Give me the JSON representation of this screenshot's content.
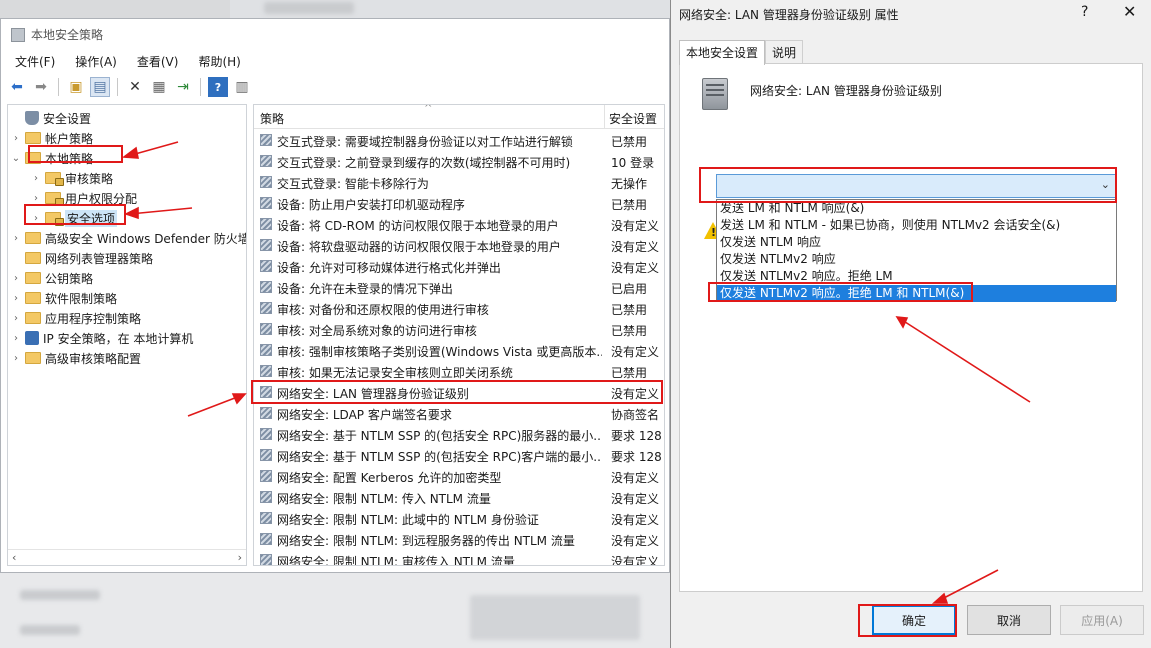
{
  "mmc": {
    "title": "本地安全策略",
    "menu": [
      "文件(F)",
      "操作(A)",
      "查看(V)",
      "帮助(H)"
    ],
    "tree": [
      {
        "label": "安全设置",
        "level": 0,
        "icon": "shield"
      },
      {
        "label": "帐户策略",
        "level": 1,
        "icon": "folder"
      },
      {
        "label": "本地策略",
        "level": 1,
        "icon": "folder",
        "expanded": true
      },
      {
        "label": "审核策略",
        "level": 2,
        "icon": "folder-lock"
      },
      {
        "label": "用户权限分配",
        "level": 2,
        "icon": "folder-lock"
      },
      {
        "label": "安全选项",
        "level": 2,
        "icon": "folder-lock",
        "selected": true
      },
      {
        "label": "高级安全 Windows Defender 防火墙",
        "level": 1,
        "icon": "folder"
      },
      {
        "label": "网络列表管理器策略",
        "level": 1,
        "icon": "folder"
      },
      {
        "label": "公钥策略",
        "level": 1,
        "icon": "folder"
      },
      {
        "label": "软件限制策略",
        "level": 1,
        "icon": "folder"
      },
      {
        "label": "应用程序控制策略",
        "level": 1,
        "icon": "folder"
      },
      {
        "label": "IP 安全策略，在 本地计算机",
        "level": 1,
        "icon": "netshield"
      },
      {
        "label": "高级审核策略配置",
        "level": 1,
        "icon": "folder"
      }
    ],
    "list_headers": {
      "policy": "策略",
      "setting": "安全设置"
    },
    "list_rows": [
      {
        "policy": "交互式登录: 需要域控制器身份验证以对工作站进行解锁",
        "setting": "已禁用"
      },
      {
        "policy": "交互式登录: 之前登录到缓存的次数(域控制器不可用时)",
        "setting": "10 登录"
      },
      {
        "policy": "交互式登录: 智能卡移除行为",
        "setting": "无操作"
      },
      {
        "policy": "设备: 防止用户安装打印机驱动程序",
        "setting": "已禁用"
      },
      {
        "policy": "设备: 将 CD-ROM 的访问权限仅限于本地登录的用户",
        "setting": "没有定义"
      },
      {
        "policy": "设备: 将软盘驱动器的访问权限仅限于本地登录的用户",
        "setting": "没有定义"
      },
      {
        "policy": "设备: 允许对可移动媒体进行格式化并弹出",
        "setting": "没有定义"
      },
      {
        "policy": "设备: 允许在未登录的情况下弹出",
        "setting": "已启用"
      },
      {
        "policy": "审核: 对备份和还原权限的使用进行审核",
        "setting": "已禁用"
      },
      {
        "policy": "审核: 对全局系统对象的访问进行审核",
        "setting": "已禁用"
      },
      {
        "policy": "审核: 强制审核策略子类别设置(Windows Vista 或更高版本...",
        "setting": "没有定义"
      },
      {
        "policy": "审核: 如果无法记录安全审核则立即关闭系统",
        "setting": "已禁用"
      },
      {
        "policy": "网络安全: LAN 管理器身份验证级别",
        "setting": "没有定义",
        "highlight": true
      },
      {
        "policy": "网络安全: LDAP 客户端签名要求",
        "setting": "协商签名"
      },
      {
        "policy": "网络安全: 基于 NTLM SSP 的(包括安全 RPC)服务器的最小...",
        "setting": "要求 128 位"
      },
      {
        "policy": "网络安全: 基于 NTLM SSP 的(包括安全 RPC)客户端的最小...",
        "setting": "要求 128 位"
      },
      {
        "policy": "网络安全: 配置 Kerberos 允许的加密类型",
        "setting": "没有定义"
      },
      {
        "policy": "网络安全: 限制 NTLM: 传入 NTLM 流量",
        "setting": "没有定义"
      },
      {
        "policy": "网络安全: 限制 NTLM: 此域中的 NTLM 身份验证",
        "setting": "没有定义"
      },
      {
        "policy": "网络安全: 限制 NTLM: 到远程服务器的传出 NTLM 流量",
        "setting": "没有定义"
      },
      {
        "policy": "网络安全: 限制 NTLM: 审核传入 NTLM 流量",
        "setting": "没有定义"
      }
    ]
  },
  "dialog": {
    "title": "网络安全: LAN 管理器身份验证级别 属性",
    "help_glyph": "?",
    "close_glyph": "✕",
    "tabs": [
      "本地安全设置",
      "说明"
    ],
    "policy_name": "网络安全: LAN 管理器身份验证级别",
    "combo_value": "",
    "options": [
      "发送 LM 和 NTLM 响应(&)",
      "发送 LM 和 NTLM - 如果已协商，则使用 NTLMv2 会话安全(&)",
      "仅发送 NTLM 响应",
      "仅发送 NTLMv2 响应",
      "仅发送 NTLMv2 响应。拒绝 LM",
      "仅发送 NTLMv2 响应。拒绝 LM 和 NTLM(&)"
    ],
    "selected_option": 5,
    "buttons": {
      "ok": "确定",
      "cancel": "取消",
      "apply": "应用(A)"
    }
  },
  "annotation_color": "#e01919"
}
